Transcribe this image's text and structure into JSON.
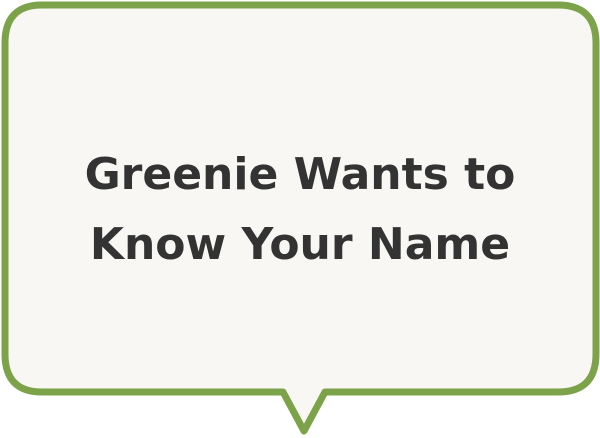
{
  "bubble": {
    "line1": "Greenie Wants to",
    "line2": "Know Your Name",
    "border_color": "#7da34a",
    "fill_color": "#f8f7f4",
    "text_color": "#333333"
  }
}
